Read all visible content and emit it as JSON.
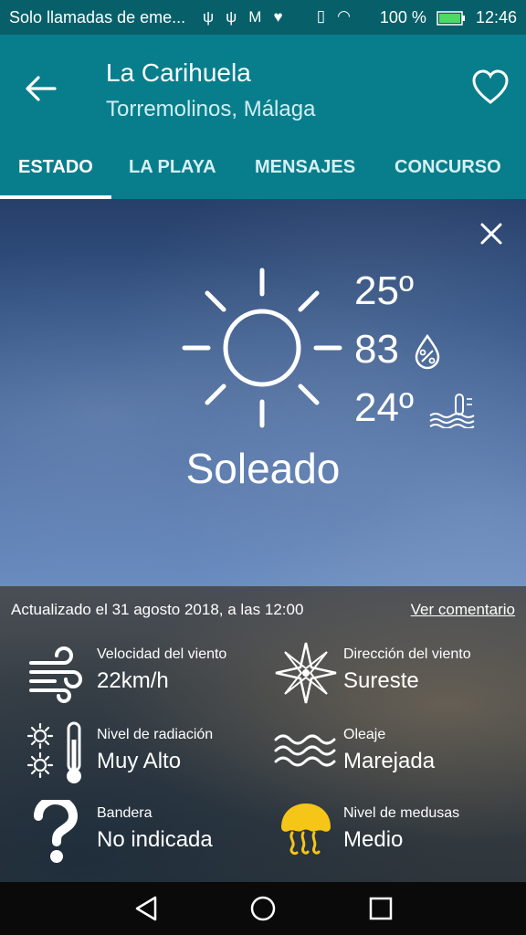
{
  "status_bar": {
    "carrier_text": "Solo llamadas de eme...",
    "battery": "100 %",
    "time": "12:46",
    "left_icons": [
      "usb-icon",
      "usb-icon",
      "gmail-icon",
      "heart-rate-icon"
    ],
    "right_icons": [
      "vibrate-icon",
      "wifi-icon",
      "no-sim-icon"
    ]
  },
  "header": {
    "title": "La Carihuela",
    "subtitle": "Torremolinos, Málaga"
  },
  "tabs": [
    {
      "label": "ESTADO"
    },
    {
      "label": "LA PLAYA"
    },
    {
      "label": "MENSAJES"
    },
    {
      "label": "CONCURSO"
    }
  ],
  "weather": {
    "temperature": "25º",
    "humidity": "83",
    "water_temperature": "24º",
    "condition": "Soleado"
  },
  "info": {
    "updated_text": "Actualizado el 31 agosto 2018, a las 12:00",
    "comment_link": "Ver comentario",
    "items": [
      {
        "label": "Velocidad del viento",
        "value": "22km/h",
        "icon": "wind-icon"
      },
      {
        "label": "Dirección del viento",
        "value": "Sureste",
        "icon": "compass-rose-icon"
      },
      {
        "label": "Nivel de radiación",
        "value": "Muy Alto",
        "icon": "radiation-thermometer-icon"
      },
      {
        "label": "Oleaje",
        "value": "Marejada",
        "icon": "waves-icon"
      },
      {
        "label": "Bandera",
        "value": "No indicada",
        "icon": "question-mark-icon"
      },
      {
        "label": "Nivel de medusas",
        "value": "Medio",
        "icon": "jellyfish-icon"
      }
    ]
  },
  "colors": {
    "app_bar": "#087e8c",
    "status_bar": "#075f69",
    "jellyfish": "#f5c518"
  }
}
